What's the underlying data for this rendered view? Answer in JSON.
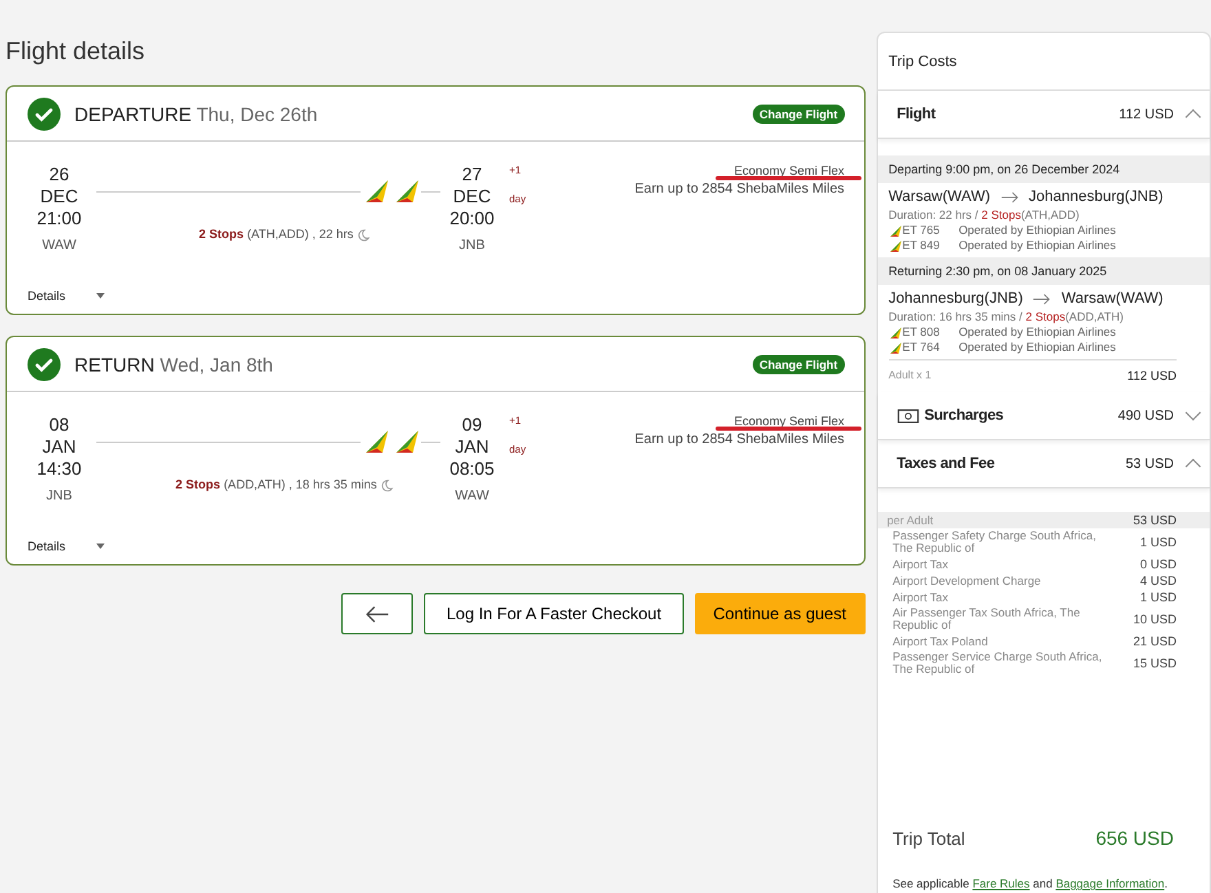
{
  "page_title": "Flight details",
  "flights": [
    {
      "label": "DEPARTURE",
      "date": "Thu, Dec 26th",
      "confirmed": true,
      "change_button": "Change Flight",
      "depart": {
        "day": "26",
        "month": "DEC",
        "time": "21:00",
        "code": "WAW"
      },
      "arrive": {
        "day": "27",
        "month": "DEC",
        "time": "20:00",
        "code": "JNB"
      },
      "day_offset": "+1",
      "day_label": "day",
      "stops": "2 Stops",
      "route": "(ATH,ADD) , 22 hrs",
      "fare": "Economy Semi Flex",
      "miles": "Earn up to 2854 ShebaMiles Miles",
      "details": "Details",
      "expanded": false
    },
    {
      "label": "RETURN",
      "date": "Wed, Jan 8th",
      "confirmed": true,
      "change_button": "Change Flight",
      "depart": {
        "day": "08",
        "month": "JAN",
        "time": "14:30",
        "code": "JNB"
      },
      "arrive": {
        "day": "09",
        "month": "JAN",
        "time": "08:05",
        "code": "WAW"
      },
      "day_offset": "+1",
      "day_label": "day",
      "stops": "2 Stops",
      "route": "(ADD,ATH) , 18 hrs 35 mins",
      "fare": "Economy Semi Flex",
      "miles": "Earn up to 2854 ShebaMiles Miles",
      "details": "Details",
      "expanded": false
    }
  ],
  "actions": {
    "login": "Log In For A Faster Checkout",
    "guest": "Continue as guest"
  },
  "trip_costs": {
    "title": "Trip Costs",
    "flight": {
      "title": "Flight",
      "amount": "112 USD",
      "expanded": true,
      "legs": [
        {
          "heading": "Departing 9:00 pm, on 26 December 2024",
          "from": "Warsaw(WAW)",
          "to": "Johannesburg(JNB)",
          "duration": "Duration: 22 hrs  / ",
          "stops": "2 Stops",
          "via": "(ATH,ADD)",
          "segments": [
            {
              "flight": "ET 765",
              "operator": "Operated by Ethiopian Airlines"
            },
            {
              "flight": "ET 849",
              "operator": "Operated by Ethiopian Airlines"
            }
          ]
        },
        {
          "heading": "Returning 2:30 pm, on 08 January 2025",
          "from": "Johannesburg(JNB)",
          "to": "Warsaw(WAW)",
          "duration": "Duration: 16 hrs 35 mins / ",
          "stops": "2 Stops",
          "via": "(ADD,ATH)",
          "segments": [
            {
              "flight": "ET 808",
              "operator": "Operated by Ethiopian Airlines"
            },
            {
              "flight": "ET 764",
              "operator": "Operated by Ethiopian Airlines"
            }
          ]
        }
      ],
      "passenger": "Adult x 1",
      "passenger_amount": "112 USD"
    },
    "surcharges": {
      "title": "Surcharges",
      "amount": "490 USD",
      "expanded": false
    },
    "taxes": {
      "title": "Taxes and Fee",
      "amount": "53 USD",
      "expanded": true,
      "rows": [
        {
          "kind": "header",
          "label": "per Adult",
          "amount": "53 USD"
        },
        {
          "kind": "item",
          "label": "Passenger Safety Charge South Africa, The Republic of",
          "amount": "1 USD"
        },
        {
          "kind": "item",
          "label": "Airport Tax",
          "amount": "0 USD"
        },
        {
          "kind": "item",
          "label": "Airport Development Charge",
          "amount": "4 USD"
        },
        {
          "kind": "item",
          "label": "Airport Tax",
          "amount": "1 USD"
        },
        {
          "kind": "item",
          "label": "Air Passenger Tax South Africa, The Republic of",
          "amount": "10 USD"
        },
        {
          "kind": "item",
          "label": "Airport Tax Poland",
          "amount": "21 USD"
        },
        {
          "kind": "item",
          "label": "Passenger Service Charge South Africa, The Republic of",
          "amount": "15 USD"
        }
      ]
    },
    "total_label": "Trip Total",
    "total": "656 USD",
    "note": {
      "prefix": "See applicable ",
      "link1": "Fare Rules",
      "middle": " and ",
      "link2": "Baggage Information",
      "suffix": "."
    }
  }
}
